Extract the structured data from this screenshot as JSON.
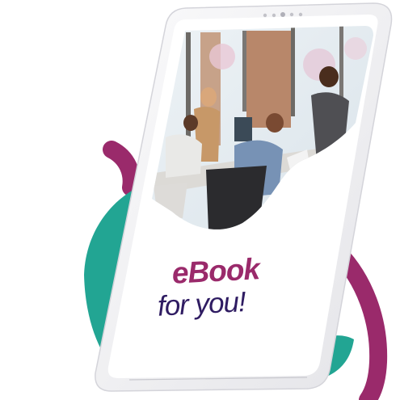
{
  "headline": {
    "line1": "eBook",
    "line2": "for you!"
  },
  "colors": {
    "magenta": "#9a2a6b",
    "teal": "#22a593",
    "navy": "#2f1c62",
    "device_frame": "#f1f1f3",
    "screen": "#ffffff"
  },
  "photo": {
    "subject": "office-team-meeting-photo"
  },
  "icons": [
    "tablet-camera-icon"
  ]
}
